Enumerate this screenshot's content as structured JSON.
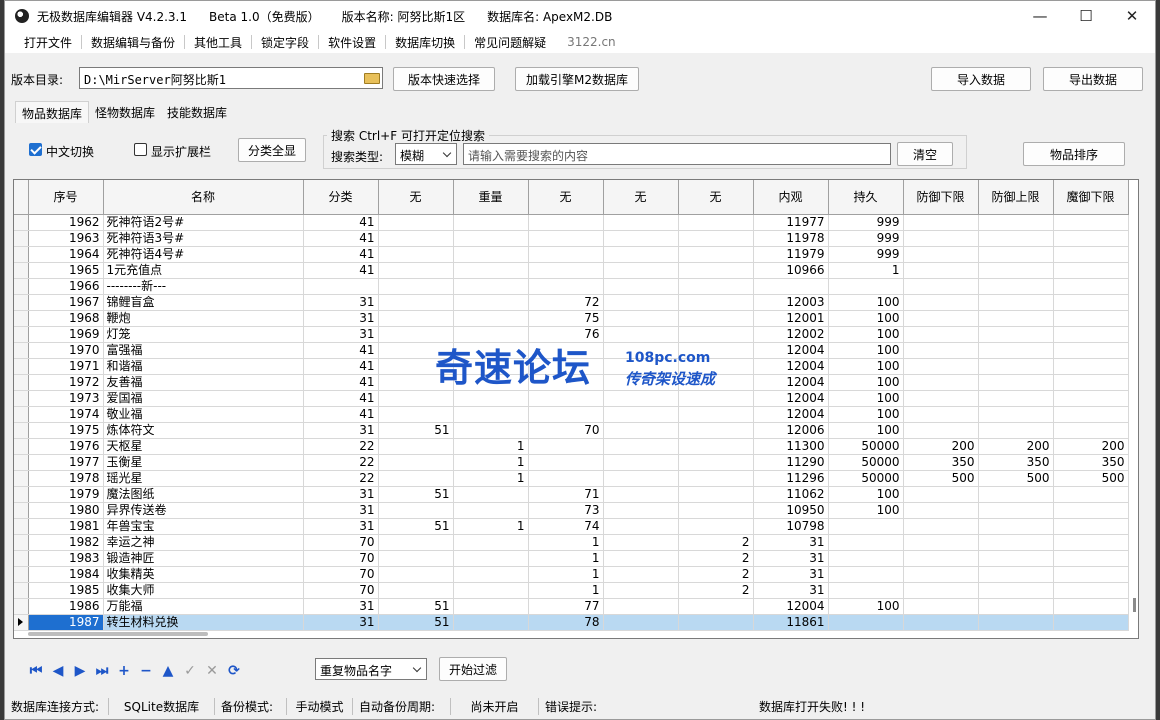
{
  "window": {
    "title_app": "无极数据库编辑器 V4.2.3.1",
    "title_edition": "Beta 1.0（免费版）",
    "title_version": "版本名称: 阿努比斯1区",
    "title_db": "数据库名: ApexM2.DB",
    "minimize": "—",
    "maximize": "☐",
    "close": "✕"
  },
  "menu": {
    "items": [
      "打开文件",
      "数据编辑与备份",
      "其他工具",
      "锁定字段",
      "软件设置",
      "数据库切换",
      "常见问题解疑"
    ],
    "site": "3122.cn"
  },
  "path": {
    "label": "版本目录:",
    "value": "D:\\MirServer阿努比斯1",
    "quick_select": "版本快速选择",
    "load_engine": "加载引擎M2数据库",
    "import": "导入数据",
    "export": "导出数据"
  },
  "tabs": [
    "物品数据库",
    "怪物数据库",
    "技能数据库"
  ],
  "options": {
    "chinese_switch": "中文切换",
    "show_ext": "显示扩展栏",
    "show_all": "分类全显",
    "search_title": "搜索   Ctrl+F 可打开定位搜索",
    "search_type_label": "搜索类型:",
    "search_type_value": "模糊",
    "search_placeholder": "请输入需要搜索的内容",
    "clear": "清空",
    "sort": "物品排序"
  },
  "table": {
    "columns": [
      "序号",
      "名称",
      "分类",
      "无",
      "重量",
      "无",
      "无",
      "无",
      "内观",
      "持久",
      "防御下限",
      "防御上限",
      "魔御下限"
    ],
    "rows": [
      [
        "1962",
        "死神符语2号#",
        "41",
        "",
        "",
        "",
        "",
        "",
        "11977",
        "999",
        "",
        "",
        ""
      ],
      [
        "1963",
        "死神符语3号#",
        "41",
        "",
        "",
        "",
        "",
        "",
        "11978",
        "999",
        "",
        "",
        ""
      ],
      [
        "1964",
        "死神符语4号#",
        "41",
        "",
        "",
        "",
        "",
        "",
        "11979",
        "999",
        "",
        "",
        ""
      ],
      [
        "1965",
        "1元充值点",
        "41",
        "",
        "",
        "",
        "",
        "",
        "10966",
        "1",
        "",
        "",
        ""
      ],
      [
        "1966",
        "--------新---",
        "",
        "",
        "",
        "",
        "",
        "",
        "",
        "",
        "",
        "",
        ""
      ],
      [
        "1967",
        "锦鲤盲盒",
        "31",
        "",
        "",
        "72",
        "",
        "",
        "12003",
        "100",
        "",
        "",
        ""
      ],
      [
        "1968",
        "鞭炮",
        "31",
        "",
        "",
        "75",
        "",
        "",
        "12001",
        "100",
        "",
        "",
        ""
      ],
      [
        "1969",
        "灯笼",
        "31",
        "",
        "",
        "76",
        "",
        "",
        "12002",
        "100",
        "",
        "",
        ""
      ],
      [
        "1970",
        "富强福",
        "41",
        "",
        "",
        "",
        "",
        "",
        "12004",
        "100",
        "",
        "",
        ""
      ],
      [
        "1971",
        "和谐福",
        "41",
        "",
        "",
        "",
        "",
        "",
        "12004",
        "100",
        "",
        "",
        ""
      ],
      [
        "1972",
        "友善福",
        "41",
        "",
        "",
        "",
        "",
        "",
        "12004",
        "100",
        "",
        "",
        ""
      ],
      [
        "1973",
        "爱国福",
        "41",
        "",
        "",
        "",
        "",
        "",
        "12004",
        "100",
        "",
        "",
        ""
      ],
      [
        "1974",
        "敬业福",
        "41",
        "",
        "",
        "",
        "",
        "",
        "12004",
        "100",
        "",
        "",
        ""
      ],
      [
        "1975",
        "炼体符文",
        "31",
        "51",
        "",
        "70",
        "",
        "",
        "12006",
        "100",
        "",
        "",
        ""
      ],
      [
        "1976",
        "天枢星",
        "22",
        "",
        "1",
        "",
        "",
        "",
        "11300",
        "50000",
        "200",
        "200",
        "200"
      ],
      [
        "1977",
        "玉衡星",
        "22",
        "",
        "1",
        "",
        "",
        "",
        "11290",
        "50000",
        "350",
        "350",
        "350"
      ],
      [
        "1978",
        "瑶光星",
        "22",
        "",
        "1",
        "",
        "",
        "",
        "11296",
        "50000",
        "500",
        "500",
        "500"
      ],
      [
        "1979",
        "魔法图纸",
        "31",
        "51",
        "",
        "71",
        "",
        "",
        "11062",
        "100",
        "",
        "",
        ""
      ],
      [
        "1980",
        "异界传送卷",
        "31",
        "",
        "",
        "73",
        "",
        "",
        "10950",
        "100",
        "",
        "",
        ""
      ],
      [
        "1981",
        "年兽宝宝",
        "31",
        "51",
        "1",
        "74",
        "",
        "",
        "10798",
        "",
        "",
        "",
        ""
      ],
      [
        "1982",
        "幸运之神",
        "70",
        "",
        "",
        "1",
        "",
        "2",
        "31",
        "",
        "",
        "",
        ""
      ],
      [
        "1983",
        "锻造神匠",
        "70",
        "",
        "",
        "1",
        "",
        "2",
        "31",
        "",
        "",
        "",
        ""
      ],
      [
        "1984",
        "收集精英",
        "70",
        "",
        "",
        "1",
        "",
        "2",
        "31",
        "",
        "",
        "",
        ""
      ],
      [
        "1985",
        "收集大师",
        "70",
        "",
        "",
        "1",
        "",
        "2",
        "31",
        "",
        "",
        "",
        ""
      ],
      [
        "1986",
        "万能福",
        "31",
        "51",
        "",
        "77",
        "",
        "",
        "12004",
        "100",
        "",
        "",
        ""
      ],
      [
        "1987",
        "转生材料兑换",
        "31",
        "51",
        "",
        "78",
        "",
        "",
        "11861",
        "",
        "",
        "",
        ""
      ]
    ],
    "selected_index": 25
  },
  "watermark": {
    "main": "奇速论坛",
    "url": "108pc.com",
    "slogan": "传奇架设速成"
  },
  "bottom": {
    "filter_value": "重复物品名字",
    "start_filter": "开始过滤"
  },
  "status": {
    "conn_label": "数据库连接方式:",
    "conn_value": "SQLite数据库",
    "backup_label": "备份模式:",
    "backup_value": "手动模式",
    "auto_label": "自动备份周期:",
    "auto_value": "尚未开启",
    "err_label": "错误提示:",
    "err_value": "数据库打开失败! ! !"
  }
}
